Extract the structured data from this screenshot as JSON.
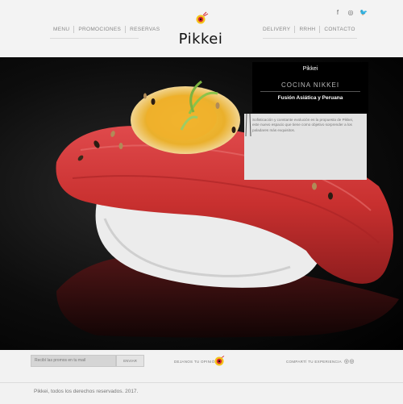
{
  "header": {
    "social_icons": [
      "facebook-icon",
      "instagram-icon",
      "twitter-icon"
    ],
    "social_glyphs": [
      "f",
      "◎",
      "🐦"
    ],
    "nav_left": [
      "MENU",
      "PROMOCIONES",
      "RESERVAS"
    ],
    "nav_right": [
      "DELIVERY",
      "RRHH",
      "CONTACTO"
    ],
    "logo_text": "Pikkei"
  },
  "hero": {
    "panel": {
      "brand": "Pikkei",
      "title": "COCINA NIKKEI",
      "subtitle": "Fusión Asiática y Peruana",
      "description": "Sofisticación y constante evolución es la propuesta de Pikkei, este nuevo espacio que tiene como objetivo sorprender a los paladares más exquisitos."
    }
  },
  "footer": {
    "newsletter_placeholder": "Recibí las promos en tu mail",
    "newsletter_button": "ENVIAR",
    "opinion_label": "DEJANOS TU OPINIÓN",
    "share_label": "COMPARTÍ TU EXPERIENCIA",
    "share_icon": "tripadvisor-icon",
    "copyright": "Pikkei, todos los derechos reservados. 2017."
  },
  "colors": {
    "logo_red": "#d7262e",
    "logo_yellow": "#f4c319",
    "tuna": "#c8302f",
    "panel_black": "#000000",
    "panel_gray": "#e3e3e3"
  }
}
